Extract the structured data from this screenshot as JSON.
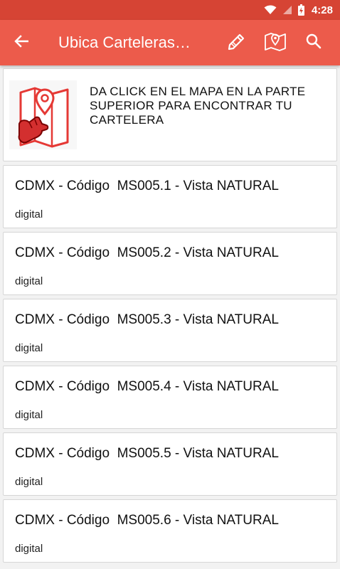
{
  "status_bar": {
    "time": "4:28"
  },
  "app_bar": {
    "title": "Ubica Carteleras…",
    "back_icon": "arrow-left-icon",
    "actions": [
      "edit-pencil-icon",
      "map-pin-icon",
      "search-icon"
    ]
  },
  "banner": {
    "text": "DA CLICK EN EL MAPA EN LA PARTE SUPERIOR PARA ENCONTRAR TU CARTELERA",
    "image_icon": "map-tap-hand-icon"
  },
  "items": [
    {
      "title": "CDMX - Código  MS005.1 - Vista NATURAL",
      "subtitle": "digital"
    },
    {
      "title": "CDMX - Código  MS005.2 - Vista NATURAL",
      "subtitle": "digital"
    },
    {
      "title": "CDMX - Código  MS005.3 - Vista NATURAL",
      "subtitle": "digital"
    },
    {
      "title": "CDMX - Código  MS005.4 - Vista NATURAL",
      "subtitle": "digital"
    },
    {
      "title": "CDMX - Código  MS005.5 - Vista NATURAL",
      "subtitle": "digital"
    },
    {
      "title": "CDMX - Código  MS005.6 - Vista NATURAL",
      "subtitle": "digital"
    }
  ],
  "colors": {
    "app_bar": "#ec5b4b",
    "status_bar": "#d64434",
    "accent_red": "#e53935"
  }
}
